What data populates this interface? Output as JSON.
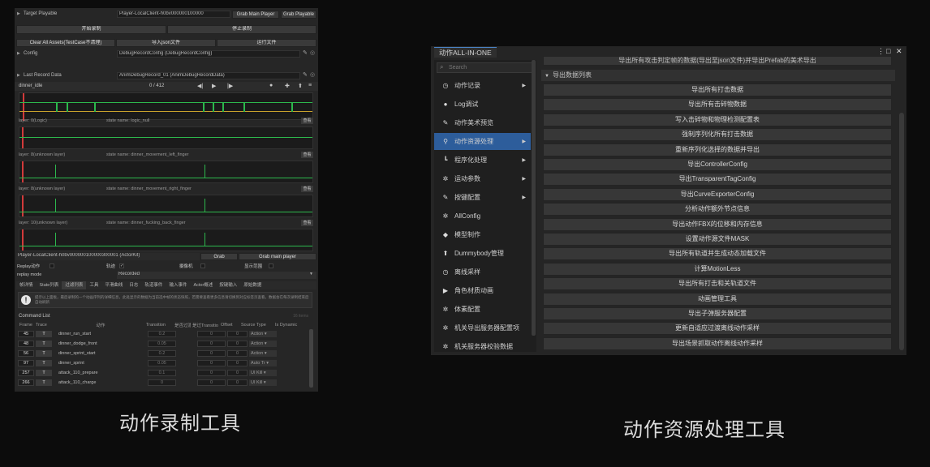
{
  "left": {
    "target_playable_label": "Target Playable",
    "target_playable_value": "Player-LocalClient-h0bv000000100000",
    "grab_main_player": "Grab Main Player",
    "grab_playable": "Grab Playable",
    "start_record": "开始录制",
    "stop_record": "停止录制",
    "clear_assets": "Clear All Assets(TestCase不清理)",
    "import_json": "导入json文件",
    "run_file": "运行文件",
    "config_label": "Config",
    "config_value": "DebugRecordConfig (DebugRecordConfig)",
    "last_record_label": "Last Record Data",
    "last_record_value": "AnimDebugRecord_01 (AnimDebugRecordData)",
    "timeline_name": "dinner_idle",
    "frame_counter": "0 / 412",
    "tracks": [
      {
        "layer": "layer: 0(Logic)",
        "state": "state name: logic_null",
        "btn": "查看"
      },
      {
        "layer": "layer: 8(unknown layer)",
        "state": "state name: dinner_movement_left_finger",
        "btn": "查看"
      },
      {
        "layer": "layer: 8(unknown layer)",
        "state": "state name: dinner_movement_right_finger",
        "btn": "查看"
      },
      {
        "layer": "layer: 10(unknown layer)",
        "state": "state name: dinner_fucking_back_finger",
        "btn": "查看"
      }
    ],
    "player_row_value": "Player-LocalClient-h0bv000000100000300001 (ActorKit)",
    "grab": "Grab",
    "grab_main_player2": "Grab main player",
    "replay_action": "Replay动作",
    "trajectory": "轨迹",
    "camera": "摄像机",
    "show_hitbox": "显示范围",
    "replay_mode_label": "replay mode",
    "replay_mode_value": "Recorded",
    "tabs": [
      "帧详情",
      "State列表",
      "过滤列表",
      "工具",
      "平滑曲线",
      "日志",
      "轨道事件",
      "输入事件",
      "Actor概述",
      "按键输入",
      "原始数据"
    ],
    "info_text": "提示以上面板，最后录制的一个动画序列的详细信息，此处显示的数据为当前选中帧的状态快照，若需要查看更多信息请切换到对应标签页查看，数据会在每次录制结束后自动刷新",
    "command_list_label": "Command List",
    "command_list_hint": "16 items",
    "table_headers": [
      "Frame",
      "Trace",
      "动作",
      "Transition",
      "是否过渡",
      "是过Transitio",
      "Offset",
      "Source Type",
      "Is Dynamic"
    ],
    "rows": [
      {
        "frame": "45",
        "trace": "T",
        "action": "dinner_run_start",
        "transition": "0.2",
        "flag": "0",
        "offset": "0",
        "source": "Action ▾"
      },
      {
        "frame": "48",
        "trace": "T",
        "action": "dinner_dodge_front",
        "transition": "0.05",
        "flag": "0",
        "offset": "0",
        "source": "Action ▾"
      },
      {
        "frame": "56",
        "trace": "T",
        "action": "dinner_sprint_start",
        "transition": "0.2",
        "flag": "0",
        "offset": "0",
        "source": "Action ▾"
      },
      {
        "frame": "97",
        "trace": "T",
        "action": "dinner_sprint",
        "transition": "0.05",
        "flag": "0",
        "offset": "0",
        "source": "Auto Tr ▾"
      },
      {
        "frame": "257",
        "trace": "T",
        "action": "attack_110_prepare",
        "transition": "0.1",
        "flag": "0",
        "offset": "0",
        "source": "UI Kill ▾"
      },
      {
        "frame": "266",
        "trace": "T",
        "action": "attack_110_charge",
        "transition": "0",
        "flag": "0",
        "offset": "0",
        "source": "UI Kill ▾"
      }
    ]
  },
  "right": {
    "window_title": "动作ALL-IN-ONE",
    "search_placeholder": "Search",
    "sidebar": [
      {
        "label": "动作记录",
        "icon": "clock-icon",
        "arrow": true
      },
      {
        "label": "Log调试",
        "icon": "chat-icon",
        "arrow": false
      },
      {
        "label": "动作美术预览",
        "icon": "brush-icon",
        "arrow": false
      },
      {
        "label": "动作资源处理",
        "icon": "link-icon",
        "arrow": true,
        "active": true
      },
      {
        "label": "程序化处理",
        "icon": "bracket-icon",
        "arrow": true
      },
      {
        "label": "运动参数",
        "icon": "gear-icon",
        "arrow": true
      },
      {
        "label": "按键配置",
        "icon": "key-icon",
        "arrow": true
      },
      {
        "label": "AllConfig",
        "icon": "gear-icon",
        "arrow": false
      },
      {
        "label": "模型制作",
        "icon": "cube-icon",
        "arrow": false
      },
      {
        "label": "Dummybody管理",
        "icon": "pin-icon",
        "arrow": false
      },
      {
        "label": "离线采样",
        "icon": "clock-icon",
        "arrow": false
      },
      {
        "label": "角色材质动画",
        "icon": "play-icon",
        "arrow": false
      },
      {
        "label": "体素配置",
        "icon": "gear-icon",
        "arrow": false
      },
      {
        "label": "机关导出服务器配置项",
        "icon": "gear-icon",
        "arrow": false
      },
      {
        "label": "机关服务器校验数据",
        "icon": "gear-icon",
        "arrow": false
      }
    ],
    "top_cut_button": "导出所有攻击判定帧的数据(导出至json文件)并导出Prefab的美术导出",
    "section_title": "导出数据列表",
    "actions": [
      "导出所有打击数据",
      "导出所有击碎物数据",
      "写入击碎物和物理检测配置表",
      "强制序列化所有打击数据",
      "重新序列化选择的数据并导出",
      "导出ControllerConfig",
      "导出TransparentTagConfig",
      "导出CurveExporterConfig",
      "分析动作额外节点信息",
      "导出动作FBX的位移和内存信息",
      "设置动作源文件MASK",
      "导出所有轨道并生成动态加载文件",
      "计算MotionLess",
      "导出所有打击和关轨道文件",
      "动画管理工具",
      "导出子弹服务器配置",
      "更新自适应过渡离线动作采样",
      "导出场景抓取动作离线动作采样"
    ]
  },
  "captions": {
    "left": "动作录制工具",
    "right": "动作资源处理工具"
  }
}
